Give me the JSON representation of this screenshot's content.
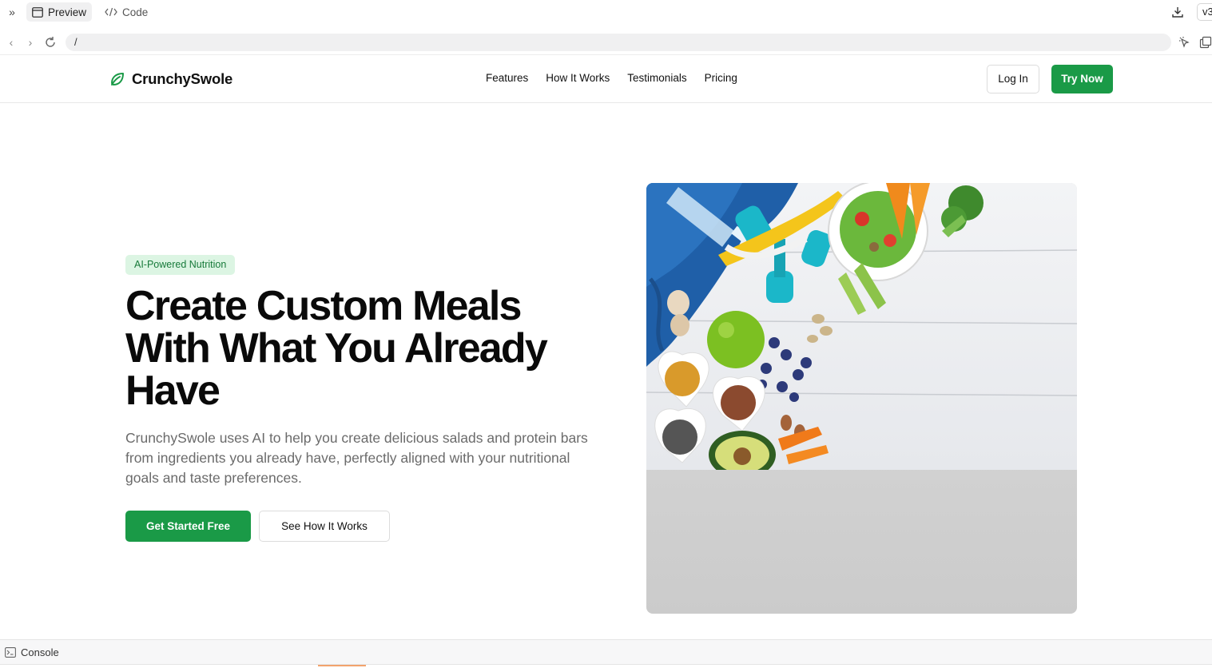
{
  "ide": {
    "tabs": [
      {
        "label": "Preview",
        "active": true,
        "icon": "window-icon"
      },
      {
        "label": "Code",
        "active": false,
        "icon": "code-icon"
      }
    ],
    "version_label": "v3",
    "url": "/"
  },
  "site": {
    "brand": "CrunchySwole",
    "brand_color": "#1a9a47",
    "nav": [
      "Features",
      "How It Works",
      "Testimonials",
      "Pricing"
    ],
    "login_label": "Log In",
    "try_label": "Try Now"
  },
  "hero": {
    "badge": "AI-Powered Nutrition",
    "title": "Create Custom Meals With What You Already Have",
    "subtitle": "CrunchySwole uses AI to help you create delicious salads and protein bars from ingredients you already have, perfectly aligned with your nutritional goals and taste preferences.",
    "primary_cta": "Get Started Free",
    "secondary_cta": "See How It Works"
  },
  "console": {
    "label": "Console"
  }
}
